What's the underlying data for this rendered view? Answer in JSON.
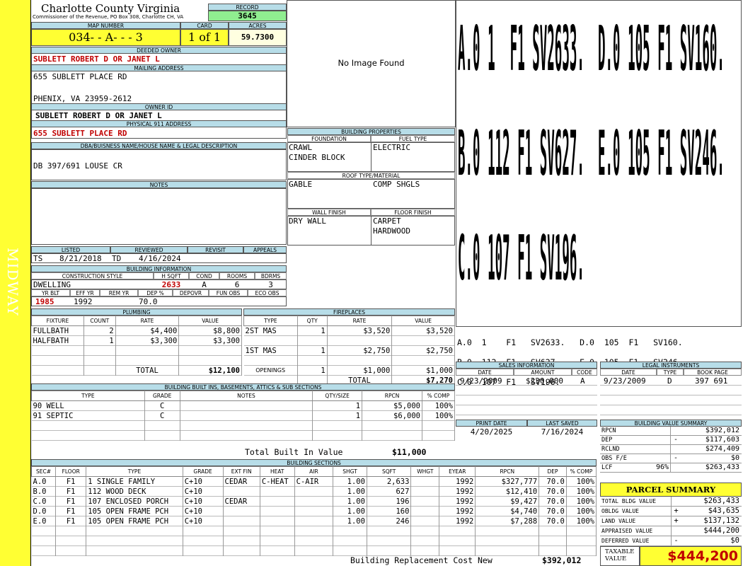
{
  "sidebar": {
    "label": "MIDWAY"
  },
  "header": {
    "title": "Charlotte County Virginia",
    "subtitle": "Commissioner of the Revenue, PO Box 308, Charlotte CH, VA",
    "record_label": "RECORD",
    "record": "3645"
  },
  "map": {
    "map_number_label": "MAP NUMBER",
    "map_number": "034- - A- - - 3",
    "card_label": "CARD",
    "card": "1 of 1",
    "acres_label": "ACRES",
    "acres": "59.7300"
  },
  "owner": {
    "deeded_label": "DEEDED OWNER",
    "deeded": "SUBLETT ROBERT D OR JANET L",
    "mailing_label": "MAILING ADDRESS",
    "mail1": "655 SUBLETT PLACE RD",
    "mail2": "PHENIX, VA 23959-2612",
    "owner_id_label": "OWNER ID",
    "owner_id": "SUBLETT ROBERT D OR JANET L",
    "physical_label": "PHYSICAL 911 ADDRESS",
    "physical": "655 SUBLETT PLACE RD"
  },
  "legal": {
    "label": "DBA/BUISNESS NAME/HOUSE NAME & LEGAL DESCRIPTION",
    "text": "DB 397/691 LOUSE CR"
  },
  "notes": {
    "label": "NOTES"
  },
  "photo": {
    "text": "No Image Found"
  },
  "building_props": {
    "label": "BUILDING PROPERTIES",
    "foundation_label": "FOUNDATION",
    "foundation1": "CRAWL",
    "foundation2": "CINDER BLOCK",
    "fuel_label": "FUEL TYPE",
    "fuel": "ELECTRIC",
    "roof_label": "ROOF TYPE/MATERIAL",
    "roof_type": "GABLE",
    "roof_material": "COMP SHGLS",
    "wall_label": "WALL FINISH",
    "wall": "DRY WALL",
    "floor_label": "FLOOR FINISH",
    "floor1": "CARPET",
    "floor2": "HARDWOOD"
  },
  "sketch": {
    "big1a": "A.0 1  F1 SV2633.",
    "big1b": "D.0 105 F1 SV160.",
    "big2a": "B.0 112 F1 SV627.",
    "big2b": "E.0 105 F1 SV246.",
    "big3a": "C.0 107 F1 SV196.",
    "small": [
      [
        "A.0",
        "1",
        "F1",
        "SV2633.",
        "D.0",
        "105",
        "F1",
        "SV160."
      ],
      [
        "B.0",
        "112",
        "F1",
        "SV627.",
        "E.0",
        "105",
        "F1",
        "SV246."
      ],
      [
        "C.0",
        "107",
        "F1",
        "SV196.",
        "",
        "",
        "",
        ""
      ]
    ]
  },
  "listed": {
    "listed_label": "LISTED",
    "listed_by": "TS",
    "listed_date": "8/21/2018",
    "reviewed_label": "REVIEWED",
    "reviewed_by": "TD",
    "reviewed_date": "4/16/2024",
    "revisit_label": "REVISIT",
    "appeals_label": "APPEALS"
  },
  "building_info": {
    "label": "BUILDING INFORMATION",
    "style_label": "CONSTRUCTION STYLE",
    "style": "DWELLING",
    "hsqft_label": "H SQFT",
    "hsqft": "2633",
    "cond_label": "COND",
    "cond": "A",
    "rooms_label": "ROOMS",
    "rooms": "6",
    "bdrms_label": "BDRMS",
    "bdrms": "3",
    "yrblt_label": "YR BLT",
    "yrblt": "1985",
    "effyr_label": "EFF YR",
    "effyr": "1992",
    "remyr_label": "REM YR",
    "remyr": "",
    "dep_label": "DEP %",
    "dep": "70.0",
    "depovr_label": "DEPOVR",
    "funobs_label": "FUN OBS",
    "ecoobs_label": "ECO OBS"
  },
  "plumbing": {
    "label": "PLUMBING",
    "cols": [
      "FIXTURE",
      "COUNT",
      "RATE",
      "VALUE"
    ],
    "rows": [
      [
        "FULLBATH",
        "2",
        "$4,400",
        "$8,800"
      ],
      [
        "HALFBATH",
        "1",
        "$3,300",
        "$3,300"
      ],
      [
        "",
        "",
        "",
        ""
      ],
      [
        "",
        "",
        "",
        ""
      ]
    ],
    "total_label": "TOTAL",
    "total": "$12,100"
  },
  "fireplaces": {
    "label": "FIREPLACES",
    "cols": [
      "TYPE",
      "QTY",
      "RATE",
      "VALUE"
    ],
    "rows": [
      [
        "2ST MAS",
        "1",
        "$3,520",
        "$3,520"
      ],
      [
        "",
        "",
        "",
        ""
      ],
      [
        "1ST MAS",
        "1",
        "$2,750",
        "$2,750"
      ],
      [
        "",
        "",
        "",
        ""
      ],
      [
        "OPENINGS",
        "1",
        "$1,000",
        "$1,000"
      ]
    ],
    "total_label": "TOTAL",
    "total": "$7,270"
  },
  "sales": {
    "label": "SALES INFORMATION",
    "cols": [
      "DATE",
      "AMOUNT",
      "CODE"
    ],
    "rows": [
      [
        "9/23/2009",
        "$230,000",
        "A"
      ]
    ]
  },
  "legal_inst": {
    "label": "LEGAL INSTRUMENTS",
    "cols": [
      "DATE",
      "TYPE",
      "BOOK PAGE"
    ],
    "rows": [
      [
        "9/23/2009",
        "D",
        "397 691"
      ]
    ]
  },
  "print": {
    "print_label": "PRINT DATE",
    "print_date": "4/20/2025",
    "saved_label": "LAST SAVED",
    "saved_date": "7/16/2024"
  },
  "builtins": {
    "label": "BUILDING BUILT INS, BASEMENTS, ATTICS & SUB SECTIONS",
    "cols": [
      "TYPE",
      "GRADE",
      "NOTES",
      "QTY/SIZE",
      "RPCN",
      "% COMP"
    ],
    "rows": [
      [
        "90 WELL",
        "C",
        "",
        "1",
        "$5,000",
        "100%"
      ],
      [
        "91 SEPTIC",
        "C",
        "",
        "1",
        "$6,000",
        "100%"
      ]
    ],
    "total_label": "Total Built In Value",
    "total": "$11,000"
  },
  "value_summary": {
    "label": "BUILDING VALUE SUMMARY",
    "rows": [
      {
        "label": "RPCN",
        "pct": "",
        "sign": "",
        "value": "$392,012"
      },
      {
        "label": "DEP",
        "pct": "",
        "sign": "-",
        "value": "$117,603"
      },
      {
        "label": "RCLND",
        "pct": "",
        "sign": "",
        "value": "$274,409"
      },
      {
        "label": "OBS F/E",
        "pct": "",
        "sign": "-",
        "value": "$0"
      },
      {
        "label": "LCF",
        "pct": "96%",
        "sign": "",
        "value": "$263,433"
      }
    ]
  },
  "parcel": {
    "label": "PARCEL SUMMARY",
    "rows": [
      {
        "label": "TOTAL BLDG VALUE",
        "sign": "",
        "value": "$263,433"
      },
      {
        "label": "OBLDG VALUE",
        "sign": "+",
        "value": "$43,635"
      },
      {
        "label": "LAND VALUE",
        "sign": "+",
        "value": "$137,132"
      },
      {
        "label": "APPRAISED VALUE",
        "sign": "",
        "value": "$444,200"
      },
      {
        "label": "DEFERRED VALUE",
        "sign": "-",
        "value": "$0"
      }
    ],
    "taxable_label": "TAXABLE VALUE",
    "taxable": "$444,200"
  },
  "sections": {
    "label": "BUILDING SECTIONS",
    "cols": [
      "SEC#",
      "FLOOR",
      "TYPE",
      "GRADE",
      "EXT FIN",
      "HEAT",
      "AIR",
      "SHGT",
      "SQFT",
      "WHGT",
      "EYEAR",
      "RPCN",
      "DEP",
      "% COMP"
    ],
    "rows": [
      [
        "A.0",
        "F1",
        "1 SINGLE FAMILY",
        "C+10",
        "CEDAR",
        "C-HEAT",
        "C-AIR",
        "1.00",
        "2,633",
        "",
        "1992",
        "$327,777",
        "70.0",
        "100%"
      ],
      [
        "B.0",
        "F1",
        "112 WOOD DECK",
        "C+10",
        "",
        "",
        "",
        "1.00",
        "627",
        "",
        "1992",
        "$12,410",
        "70.0",
        "100%"
      ],
      [
        "C.0",
        "F1",
        "107 ENCLOSED PORCH",
        "C+10",
        "CEDAR",
        "",
        "",
        "1.00",
        "196",
        "",
        "1992",
        "$9,427",
        "70.0",
        "100%"
      ],
      [
        "D.0",
        "F1",
        "105 OPEN FRAME PCH",
        "C+10",
        "",
        "",
        "",
        "1.00",
        "160",
        "",
        "1992",
        "$4,740",
        "70.0",
        "100%"
      ],
      [
        "E.0",
        "F1",
        "105 OPEN FRAME PCH",
        "C+10",
        "",
        "",
        "",
        "1.00",
        "246",
        "",
        "1992",
        "$7,288",
        "70.0",
        "100%"
      ]
    ],
    "total_label": "Building Replacement Cost New",
    "total": "$392,012"
  }
}
